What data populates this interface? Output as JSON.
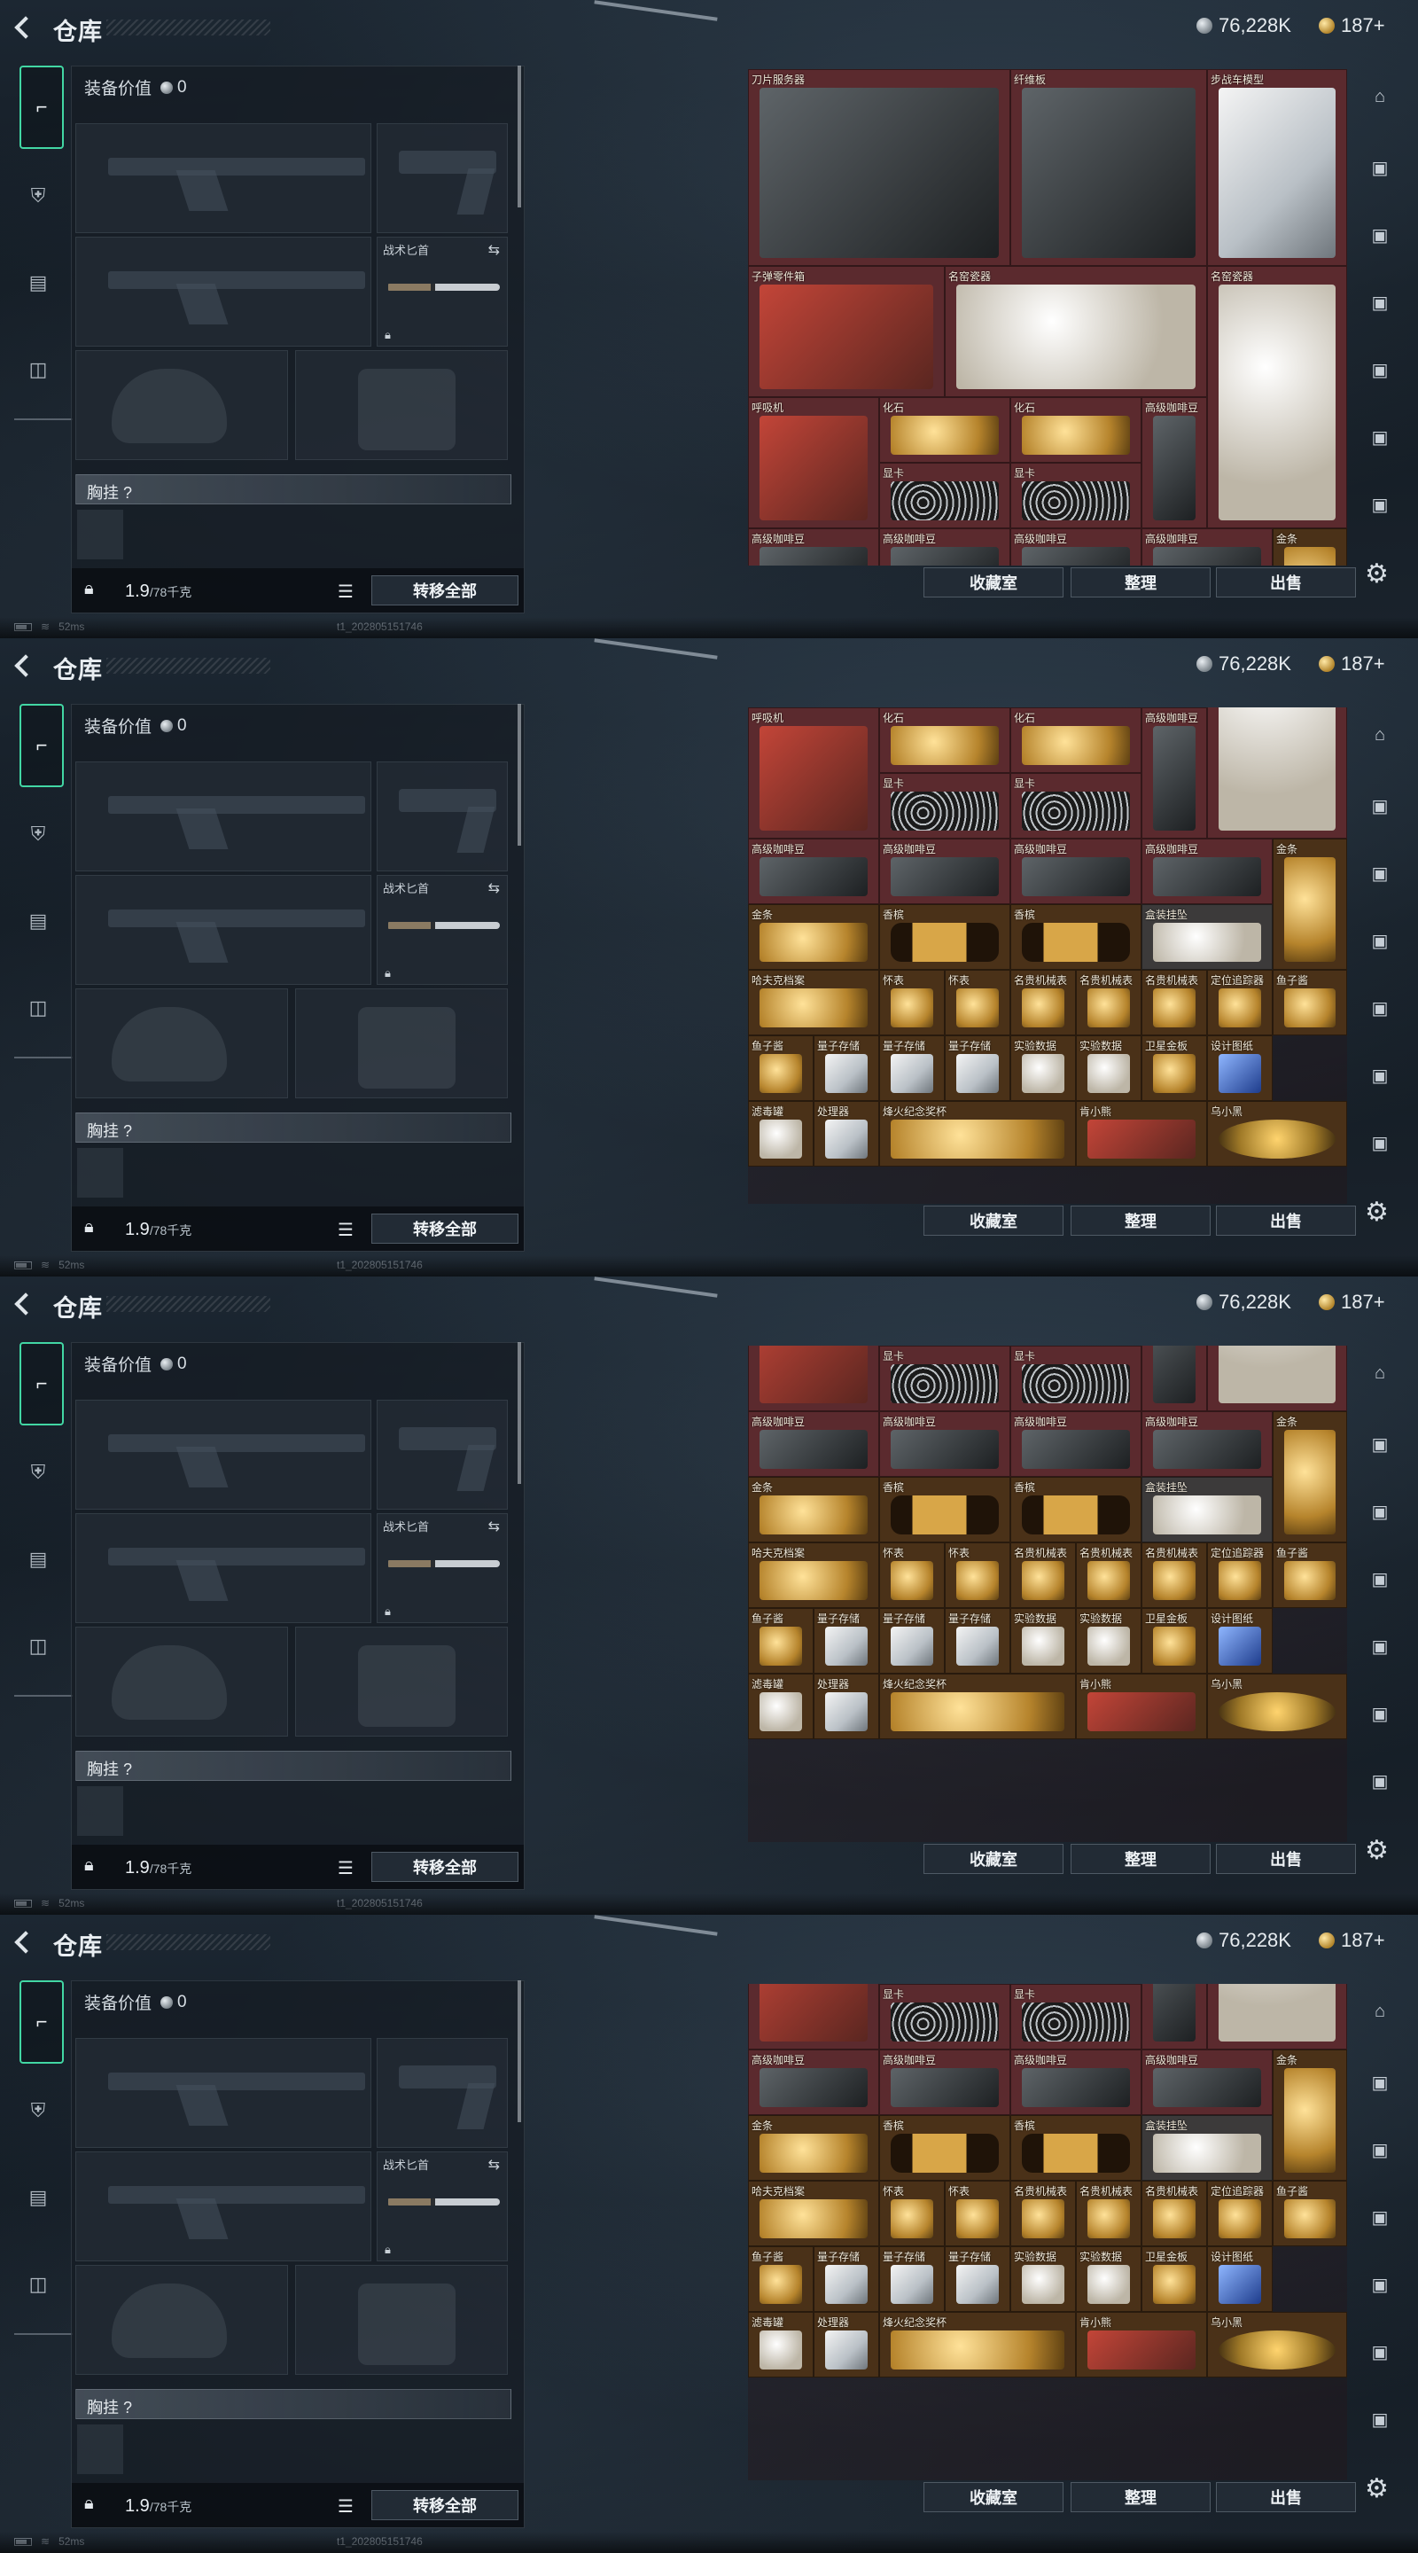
{
  "header": {
    "title": "仓库",
    "silver_amount": "76,228K",
    "gold_amount": "187+"
  },
  "equipment": {
    "value_label": "装备价值",
    "value_amount": "0",
    "knife_slot_label": "战术匕首",
    "vest_label": "胸挂 ?",
    "weight_value": "1.9",
    "weight_capacity": "/78千克",
    "transfer_all_label": "转移全部"
  },
  "storage": {
    "vault_label": "收藏室",
    "sort_label": "整理",
    "sell_label": "出售",
    "top_items": [
      {
        "name": "刀片服务器",
        "rarity": "red",
        "art": "dark"
      },
      {
        "name": "纤维板",
        "rarity": "red",
        "art": "dark"
      },
      {
        "name": "步战车模型",
        "rarity": "red",
        "art": "crystal"
      },
      {
        "name": "子弹零件箱",
        "rarity": "red",
        "art": "red"
      },
      {
        "name": "名窑瓷器",
        "rarity": "red",
        "art": "white"
      },
      {
        "name": "名窑瓷器",
        "rarity": "red",
        "art": "white"
      }
    ],
    "mid_items": [
      {
        "name": "呼吸机",
        "rarity": "red",
        "art": "red"
      },
      {
        "name": "化石",
        "rarity": "red",
        "art": "gold"
      },
      {
        "name": "化石",
        "rarity": "red",
        "art": "gold"
      },
      {
        "name": "高级咖啡豆",
        "rarity": "red",
        "art": "dark"
      },
      {
        "name": "显卡",
        "rarity": "red",
        "art": "gpu"
      },
      {
        "name": "显卡",
        "rarity": "red",
        "art": "gpu"
      }
    ],
    "grid_rows": [
      [
        {
          "name": "高级咖啡豆",
          "rarity": "red",
          "art": "dark"
        },
        {
          "name": "高级咖啡豆",
          "rarity": "red",
          "art": "dark"
        },
        {
          "name": "高级咖啡豆",
          "rarity": "red",
          "art": "dark"
        },
        {
          "name": "高级咖啡豆",
          "rarity": "red",
          "art": "dark"
        },
        {
          "name": "金条",
          "rarity": "gold",
          "art": "gold"
        }
      ],
      [
        {
          "name": "金条",
          "rarity": "gold",
          "art": "gold"
        },
        {
          "name": "香槟",
          "rarity": "gold",
          "art": "bottle"
        },
        {
          "name": "香槟",
          "rarity": "gold",
          "art": "bottle"
        },
        {
          "name": "盒装挂坠",
          "rarity": "white",
          "art": "white"
        }
      ],
      [
        {
          "name": "哈夫克档案",
          "rarity": "gold",
          "art": "gold"
        },
        {
          "name": "怀表",
          "rarity": "gold",
          "art": "gold"
        },
        {
          "name": "怀表",
          "rarity": "gold",
          "art": "gold"
        },
        {
          "name": "名贵机械表",
          "rarity": "gold",
          "art": "gold"
        },
        {
          "name": "名贵机械表",
          "rarity": "gold",
          "art": "gold"
        },
        {
          "name": "名贵机械表",
          "rarity": "gold",
          "art": "gold"
        },
        {
          "name": "定位追踪器",
          "rarity": "gold",
          "art": "gold"
        },
        {
          "name": "鱼子酱",
          "rarity": "gold",
          "art": "gold"
        }
      ],
      [
        {
          "name": "鱼子酱",
          "rarity": "gold",
          "art": "gold"
        },
        {
          "name": "量子存储",
          "rarity": "gold",
          "art": "crystal"
        },
        {
          "name": "量子存储",
          "rarity": "gold",
          "art": "crystal"
        },
        {
          "name": "量子存储",
          "rarity": "gold",
          "art": "crystal"
        },
        {
          "name": "实验数据",
          "rarity": "gold",
          "art": "white"
        },
        {
          "name": "实验数据",
          "rarity": "gold",
          "art": "white"
        },
        {
          "name": "卫星金板",
          "rarity": "gold",
          "art": "gold"
        },
        {
          "name": "设计图纸",
          "rarity": "gold",
          "art": "blue"
        }
      ],
      [
        {
          "name": "滤毒罐",
          "rarity": "gold",
          "art": "white"
        },
        {
          "name": "处理器",
          "rarity": "gold",
          "art": "crystal"
        },
        {
          "name": "烽火纪念奖杯",
          "rarity": "gold",
          "art": "gold"
        },
        {
          "name": "肯小熊",
          "rarity": "gold",
          "art": "red"
        },
        {
          "name": "乌小黑",
          "rarity": "gold",
          "art": "chain"
        }
      ]
    ]
  },
  "status": {
    "ping": "52ms",
    "build": "t1_202805151746"
  },
  "colors": {
    "accent": "#42d7a4",
    "red_rarity": "#5b2a2e",
    "gold_rarity": "#4a3118"
  }
}
